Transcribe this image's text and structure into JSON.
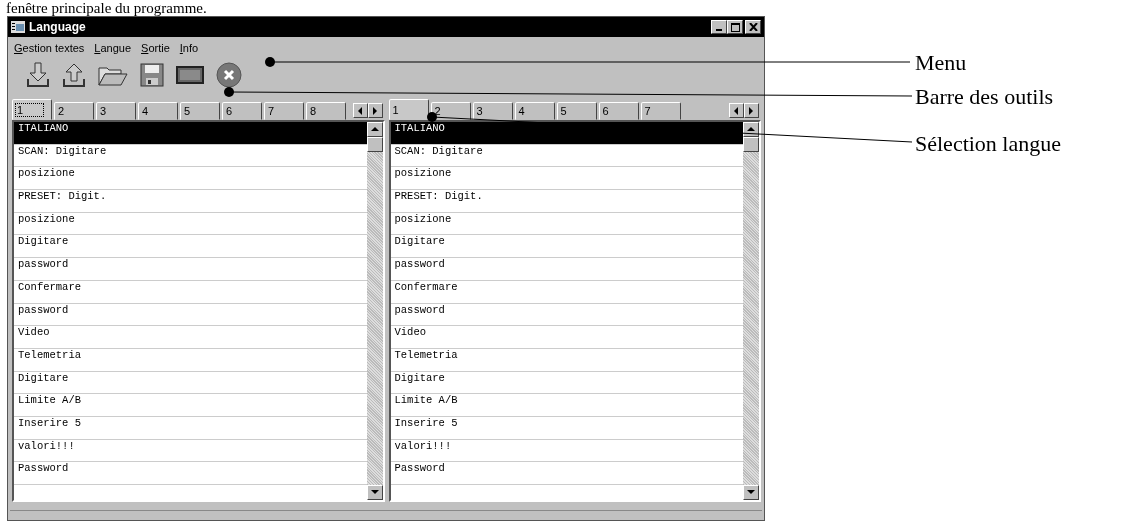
{
  "caption": "fenêtre principale du programme.",
  "window": {
    "title": "Language"
  },
  "menu": [
    "Gestion textes",
    "Langue",
    "Sortie",
    "Info"
  ],
  "panels": [
    {
      "tabs": [
        {
          "label": "1",
          "selected": true
        },
        {
          "label": "2",
          "selected": false
        },
        {
          "label": "3",
          "selected": false
        },
        {
          "label": "4",
          "selected": false
        },
        {
          "label": "5",
          "selected": false
        },
        {
          "label": "6",
          "selected": false
        },
        {
          "label": "7",
          "selected": false
        },
        {
          "label": "8",
          "selected": false
        }
      ],
      "rows": [
        {
          "text": "ITALIANO",
          "selected": true
        },
        {
          "text": "SCAN: Digitare",
          "selected": false
        },
        {
          "text": "posizione",
          "selected": false
        },
        {
          "text": "PRESET: Digit.",
          "selected": false
        },
        {
          "text": "posizione",
          "selected": false
        },
        {
          "text": "Digitare",
          "selected": false
        },
        {
          "text": "password",
          "selected": false
        },
        {
          "text": "Confermare",
          "selected": false
        },
        {
          "text": "password",
          "selected": false
        },
        {
          "text": "Video",
          "selected": false
        },
        {
          "text": "Telemetria",
          "selected": false
        },
        {
          "text": "Digitare",
          "selected": false
        },
        {
          "text": "Limite A/B",
          "selected": false
        },
        {
          "text": "Inserire 5",
          "selected": false
        },
        {
          "text": "valori!!!",
          "selected": false
        },
        {
          "text": "Password",
          "selected": false
        }
      ]
    },
    {
      "tabs": [
        {
          "label": "1",
          "selected": true
        },
        {
          "label": "2",
          "selected": false
        },
        {
          "label": "3",
          "selected": false
        },
        {
          "label": "4",
          "selected": false
        },
        {
          "label": "5",
          "selected": false
        },
        {
          "label": "6",
          "selected": false
        },
        {
          "label": "7",
          "selected": false
        }
      ],
      "rows": [
        {
          "text": "ITALIANO",
          "selected": true
        },
        {
          "text": "SCAN: Digitare",
          "selected": false
        },
        {
          "text": "posizione",
          "selected": false
        },
        {
          "text": "PRESET: Digit.",
          "selected": false
        },
        {
          "text": "posizione",
          "selected": false
        },
        {
          "text": "Digitare",
          "selected": false
        },
        {
          "text": "password",
          "selected": false
        },
        {
          "text": "Confermare",
          "selected": false
        },
        {
          "text": "password",
          "selected": false
        },
        {
          "text": "Video",
          "selected": false
        },
        {
          "text": "Telemetria",
          "selected": false
        },
        {
          "text": "Digitare",
          "selected": false
        },
        {
          "text": "Limite A/B",
          "selected": false
        },
        {
          "text": "Inserire 5",
          "selected": false
        },
        {
          "text": "valori!!!",
          "selected": false
        },
        {
          "text": "Password",
          "selected": false
        }
      ]
    }
  ],
  "annotations": [
    "Menu",
    "Barre des outils",
    "Sélection langue"
  ]
}
